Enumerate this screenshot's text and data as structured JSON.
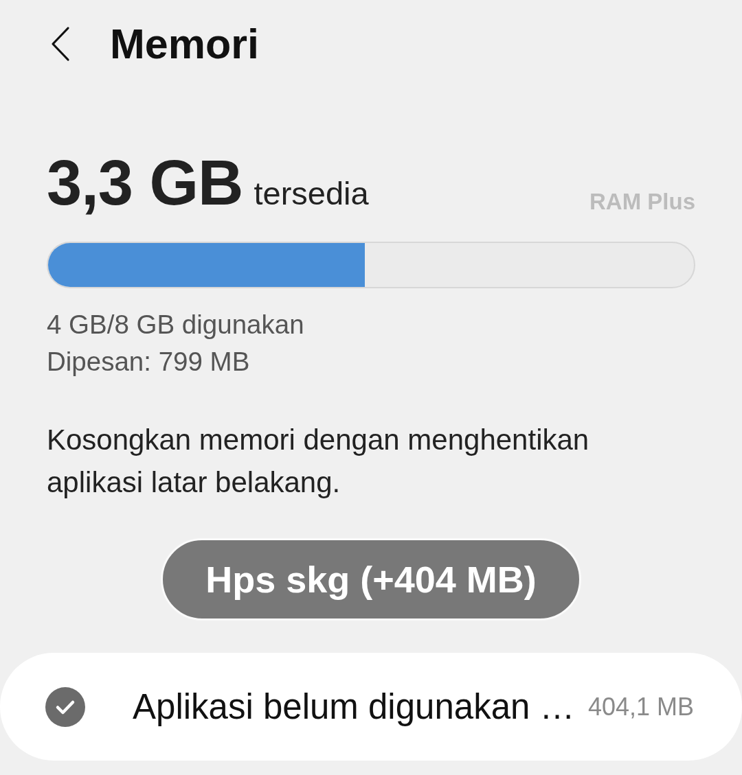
{
  "header": {
    "title": "Memori"
  },
  "memory": {
    "available": "3,3 GB",
    "available_label": "tersedia",
    "ram_plus_label": "RAM Plus",
    "usage_bar": {
      "level": 0.49
    },
    "used": "4 GB/8 GB digunakan",
    "reserved": "Dipesan: 799 MB"
  },
  "description": "Kosongkan memori dengan menghentikan aplikasi latar belakang.",
  "clean_button": {
    "label": "Hps skg (+404 MB)"
  },
  "items": [
    {
      "label": "Aplikasi belum digunakan …",
      "size": "404,1 MB",
      "checked": true
    }
  ]
}
